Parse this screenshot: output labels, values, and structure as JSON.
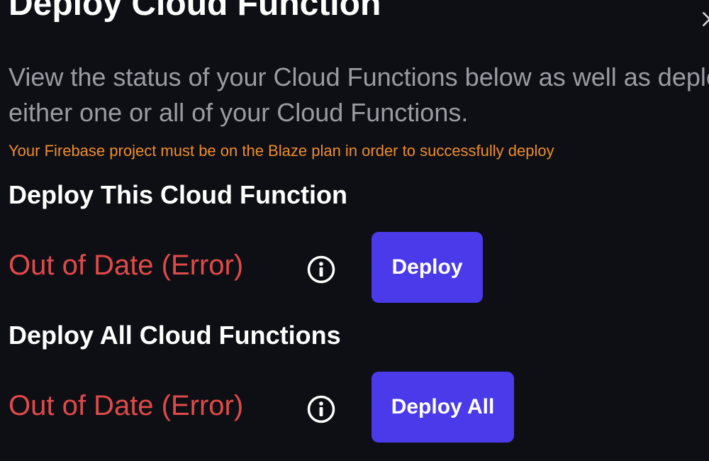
{
  "dialog": {
    "title": "Deploy Cloud Function",
    "description": "View the status of your Cloud Functions below as well as deploy either one or all of your Cloud Functions.",
    "warning": "Your Firebase project must be on the Blaze plan in order to successfully deploy"
  },
  "deploy_single": {
    "heading": "Deploy This Cloud Function",
    "status": "Out of Date (Error)",
    "button_label": "Deploy"
  },
  "deploy_all": {
    "heading": "Deploy All Cloud Functions",
    "status": "Out of Date (Error)",
    "button_label": "Deploy All"
  },
  "colors": {
    "background": "#0e0f14",
    "error": "#e04a4a",
    "warning": "#ee8d2c",
    "primary_button": "#4a3aea",
    "muted_text": "#9a9ba3"
  },
  "icons": [
    "close-icon",
    "info-icon"
  ]
}
